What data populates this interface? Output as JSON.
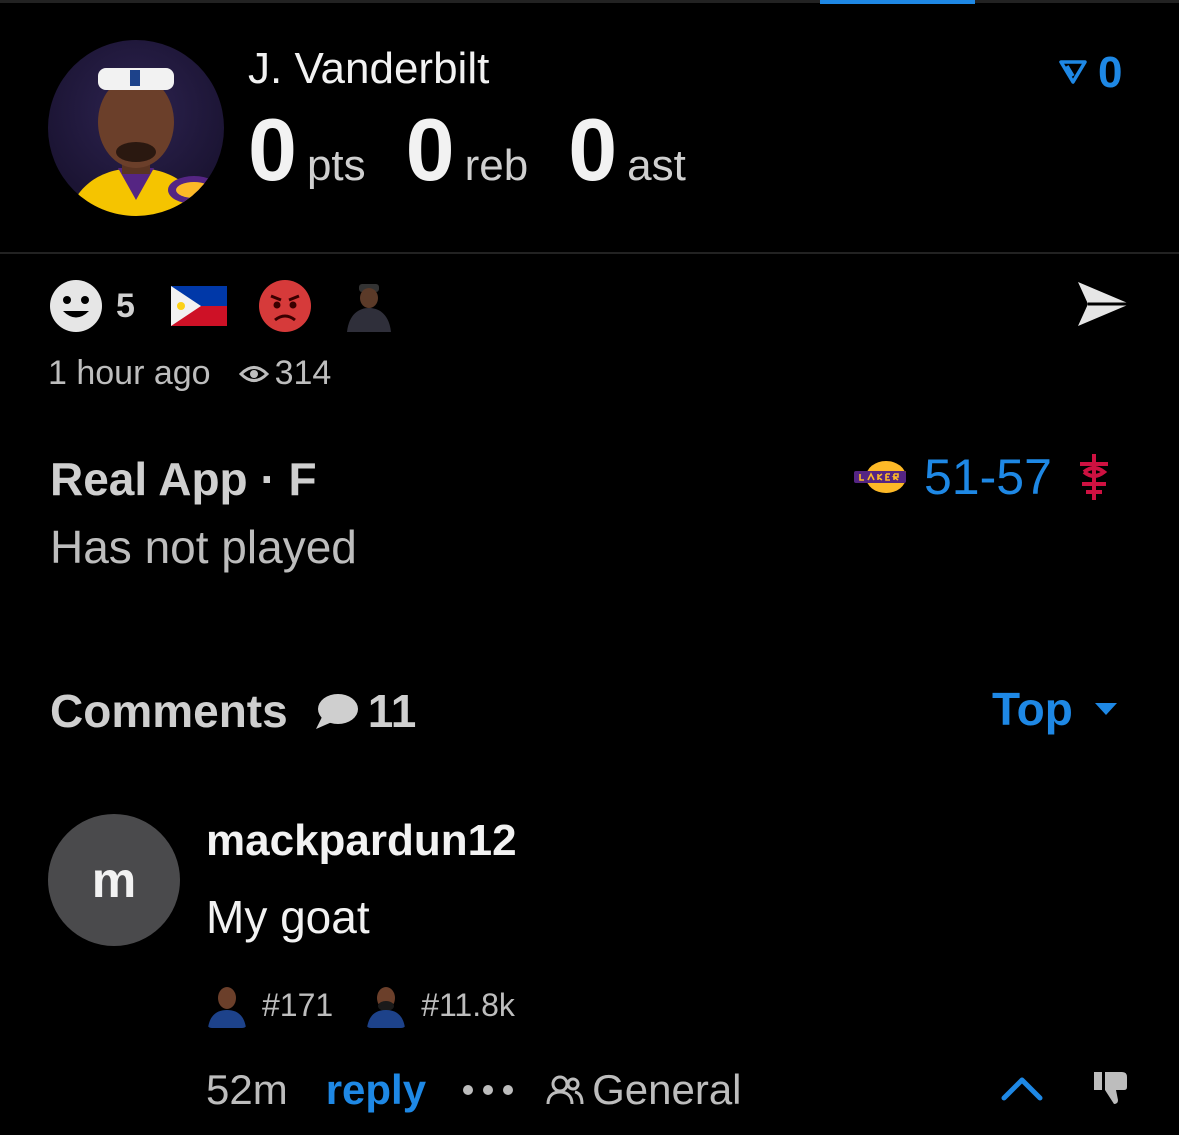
{
  "header": {
    "player_name": "J. Vanderbilt",
    "stats": [
      {
        "value": "0",
        "unit": "pts"
      },
      {
        "value": "0",
        "unit": "reb"
      },
      {
        "value": "0",
        "unit": "ast"
      }
    ],
    "vote_count": "0"
  },
  "post": {
    "reaction_count": "5",
    "time_ago": "1 hour ago",
    "views": "314",
    "source": "Real App · F",
    "status": "Has not played",
    "game_score": "51-57"
  },
  "comments": {
    "title": "Comments",
    "count": "11",
    "sort_label": "Top",
    "items": [
      {
        "avatar_letter": "m",
        "username": "mackpardun12",
        "text": "My goat",
        "badges": [
          {
            "rank": "#171"
          },
          {
            "rank": "#11.8k"
          }
        ],
        "time": "52m",
        "reply_label": "reply",
        "channel": "General"
      }
    ]
  },
  "colors": {
    "accent": "#1e88e5",
    "background": "#000000",
    "rockets_red": "#ce1141",
    "lakers_gold": "#fdb927",
    "lakers_purple": "#552583"
  },
  "icons": [
    "upvote-icon",
    "smiley-icon",
    "philippines-flag-icon",
    "angry-emoji-icon",
    "share-icon",
    "eye-icon",
    "lakers-logo",
    "rockets-logo",
    "comment-bubble-icon",
    "chevron-down-icon",
    "more-icon",
    "people-icon",
    "chevron-up-icon",
    "thumbs-down-icon"
  ]
}
